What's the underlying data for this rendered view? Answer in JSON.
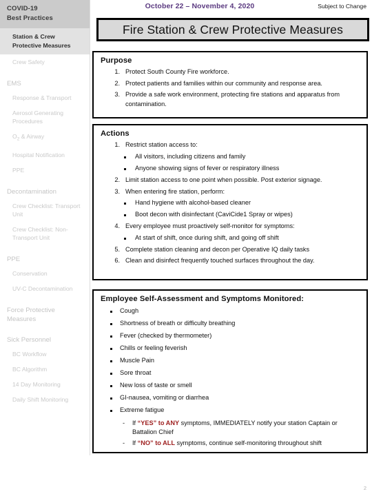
{
  "header": {
    "date_range": "October 22 – November 4, 2020",
    "subject_to_change": "Subject to Change",
    "title": "Fire Station & Crew Protective Measures",
    "date_color": "#5B3A80"
  },
  "sidebar": {
    "header_line1": "COVID-19",
    "header_line2": "Best Practices",
    "current_line1": "Station & Crew",
    "current_line2": "Protective Measures",
    "items": [
      {
        "label": "Crew Safety",
        "type": "sub"
      },
      {
        "label": "EMS",
        "type": "group"
      },
      {
        "label": "Response & Transport",
        "type": "sub"
      },
      {
        "label": "Aerosol Generating Procedures",
        "type": "sub"
      },
      {
        "label": "O2 & Airway",
        "type": "sub",
        "subscript": "2",
        "prefix": "O",
        "suffix": " & Airway"
      },
      {
        "label": "Hospital Notification",
        "type": "sub"
      },
      {
        "label": "PPE",
        "type": "sub"
      },
      {
        "label": "Decontamination",
        "type": "group"
      },
      {
        "label": "Crew Checklist: Transport Unit",
        "type": "sub"
      },
      {
        "label": "Crew Checklist: Non-Transport Unit",
        "type": "sub"
      },
      {
        "label": "PPE",
        "type": "group"
      },
      {
        "label": "Conservation",
        "type": "sub"
      },
      {
        "label": "UV-C Decontamination",
        "type": "sub"
      },
      {
        "label": "Force Protective Measures",
        "type": "group"
      },
      {
        "label": "Sick Personnel",
        "type": "group"
      },
      {
        "label": "BC Workflow",
        "type": "sub"
      },
      {
        "label": "BC Algorithm",
        "type": "sub"
      },
      {
        "label": "14 Day Monitoring",
        "type": "sub"
      },
      {
        "label": "Daily Shift Monitoring",
        "type": "sub"
      }
    ]
  },
  "purpose": {
    "heading": "Purpose",
    "items": [
      "Protect South County Fire workforce.",
      "Protect patients and families within our community and response area.",
      "Provide a safe work environment, protecting fire stations and apparatus from contamination."
    ]
  },
  "actions": {
    "heading": "Actions",
    "item1": "Restrict station access to:",
    "item1_subs": [
      "All visitors, including citizens and family",
      "Anyone showing signs of fever or respiratory illness"
    ],
    "item2": "Limit station access to one point when possible.  Post exterior signage.",
    "item3": "When entering fire station, perform:",
    "item3_subs": [
      "Hand hygiene with alcohol-based cleaner",
      "Boot decon with disinfectant (CaviCide1 Spray or wipes)"
    ],
    "item4": "Every employee must proactively self-monitor for symptoms:",
    "item4_subs": [
      "At start of shift, once during shift, and going off shift"
    ],
    "item5": "Complete station cleaning and decon per Operative IQ daily tasks",
    "item6": "Clean and disinfect frequently touched surfaces throughout the day."
  },
  "symptoms": {
    "heading": "Employee Self-Assessment and Symptoms Monitored:",
    "items": [
      "Cough",
      "Shortness of breath or difficulty breathing",
      "Fever (checked by thermometer)",
      "Chills or feeling feverish",
      "Muscle Pain",
      "Sore throat",
      "New loss of taste or smell",
      "GI-nausea, vomiting or diarrhea",
      "Extreme fatigue"
    ],
    "notes": [
      {
        "lead": "If ",
        "emphasis": "“YES” to ANY",
        "rest": " symptoms, IMMEDIATELY notify your station Captain or Battalion Chief"
      },
      {
        "lead": "If ",
        "emphasis": "“NO” to ALL",
        "rest": " symptoms, continue self-monitoring throughout shift"
      }
    ],
    "emphasis_color": "#9E2020"
  },
  "footer": {
    "page_number": "2"
  }
}
